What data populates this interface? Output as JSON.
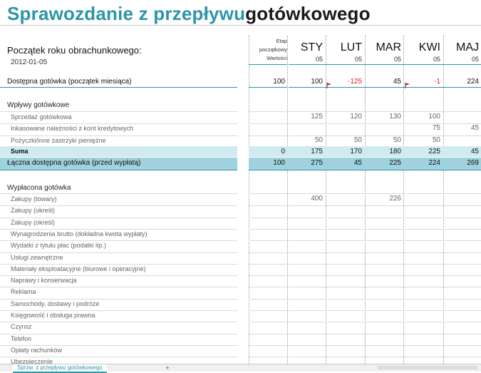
{
  "title": {
    "part1": "Sprawozdanie z przepływu",
    "part2": "gotówkowego"
  },
  "start": {
    "label": "Początek roku obrachunkowego:",
    "date": "2012-01-05"
  },
  "etap": {
    "line1": "Etap",
    "line2": "początkowy",
    "line3": "Wartości"
  },
  "months": [
    {
      "name": "STY",
      "sub": "05"
    },
    {
      "name": "LUT",
      "sub": "05"
    },
    {
      "name": "MAR",
      "sub": "05"
    },
    {
      "name": "KWI",
      "sub": "05"
    },
    {
      "name": "MAJ",
      "sub": "05"
    }
  ],
  "available": {
    "label": "Dostępna gotówka (początek miesiąca)",
    "initial": "100",
    "values": [
      "100",
      "-125",
      "45",
      "-1",
      "224"
    ]
  },
  "inflows": {
    "header": "Wpływy gotówkowe",
    "rows": [
      {
        "label": "Sprzedaż gotówkowa",
        "initial": "",
        "values": [
          "125",
          "120",
          "130",
          "100",
          ""
        ]
      },
      {
        "label": "Inkasowane należności z kont kredytowych",
        "initial": "",
        "values": [
          "",
          "",
          "",
          "75",
          "45"
        ]
      },
      {
        "label": "Pożyczki/inne zastrzyki pieniężne",
        "initial": "",
        "values": [
          "50",
          "50",
          "50",
          "50",
          ""
        ]
      }
    ],
    "sum": {
      "label": "Suma",
      "initial": "0",
      "values": [
        "175",
        "170",
        "180",
        "225",
        "45"
      ]
    },
    "total": {
      "label": "Łączna dostępna gotówka (przed wypłatą)",
      "initial": "100",
      "values": [
        "275",
        "45",
        "225",
        "224",
        "269"
      ]
    }
  },
  "outflows": {
    "header": "Wypłacona gotówka",
    "rows": [
      {
        "label": "Zakupy (towary)",
        "initial": "",
        "values": [
          "400",
          "",
          "226",
          "",
          ""
        ]
      },
      {
        "label": "Zakupy (określ)",
        "initial": "",
        "values": [
          "",
          "",
          "",
          "",
          ""
        ]
      },
      {
        "label": "Zakupy (określ)",
        "initial": "",
        "values": [
          "",
          "",
          "",
          "",
          ""
        ]
      },
      {
        "label": "Wynagrodzenia brutto (dokładna kwota wypłaty)",
        "initial": "",
        "values": [
          "",
          "",
          "",
          "",
          ""
        ]
      },
      {
        "label": "Wydatki z tytułu płac (podatki itp.)",
        "initial": "",
        "values": [
          "",
          "",
          "",
          "",
          ""
        ]
      },
      {
        "label": "Usługi zewnętrzne",
        "initial": "",
        "values": [
          "",
          "",
          "",
          "",
          ""
        ]
      },
      {
        "label": "Materiały eksploatacyjne (biurowe i operacyjne)",
        "initial": "",
        "values": [
          "",
          "",
          "",
          "",
          ""
        ]
      },
      {
        "label": "Naprawy i konserwacja",
        "initial": "",
        "values": [
          "",
          "",
          "",
          "",
          ""
        ]
      },
      {
        "label": "Reklama",
        "initial": "",
        "values": [
          "",
          "",
          "",
          "",
          ""
        ]
      },
      {
        "label": "Samochody, dostawy i podróże",
        "initial": "",
        "values": [
          "",
          "",
          "",
          "",
          ""
        ]
      },
      {
        "label": "Księgowość i obsługa prawna",
        "initial": "",
        "values": [
          "",
          "",
          "",
          "",
          ""
        ]
      },
      {
        "label": "Czynsz",
        "initial": "",
        "values": [
          "",
          "",
          "",
          "",
          ""
        ]
      },
      {
        "label": "Telefon",
        "initial": "",
        "values": [
          "",
          "",
          "",
          "",
          ""
        ]
      },
      {
        "label": "Opłaty rachunków",
        "initial": "",
        "values": [
          "",
          "",
          "",
          "",
          ""
        ]
      },
      {
        "label": "Ubezpieczenie",
        "initial": "",
        "values": [
          "",
          "",
          "",
          "",
          ""
        ]
      }
    ]
  },
  "sheet_tab": "Sprzw. z przepływu gotówkowego",
  "add_sheet": "+",
  "colors": {
    "accent": "#2e95a8",
    "negative": "#e02020",
    "suma_band": "#d0eaf1",
    "total_band": "#9fd2de"
  },
  "icons": {
    "flag": "red-flag-icon",
    "add": "add-sheet-icon"
  }
}
